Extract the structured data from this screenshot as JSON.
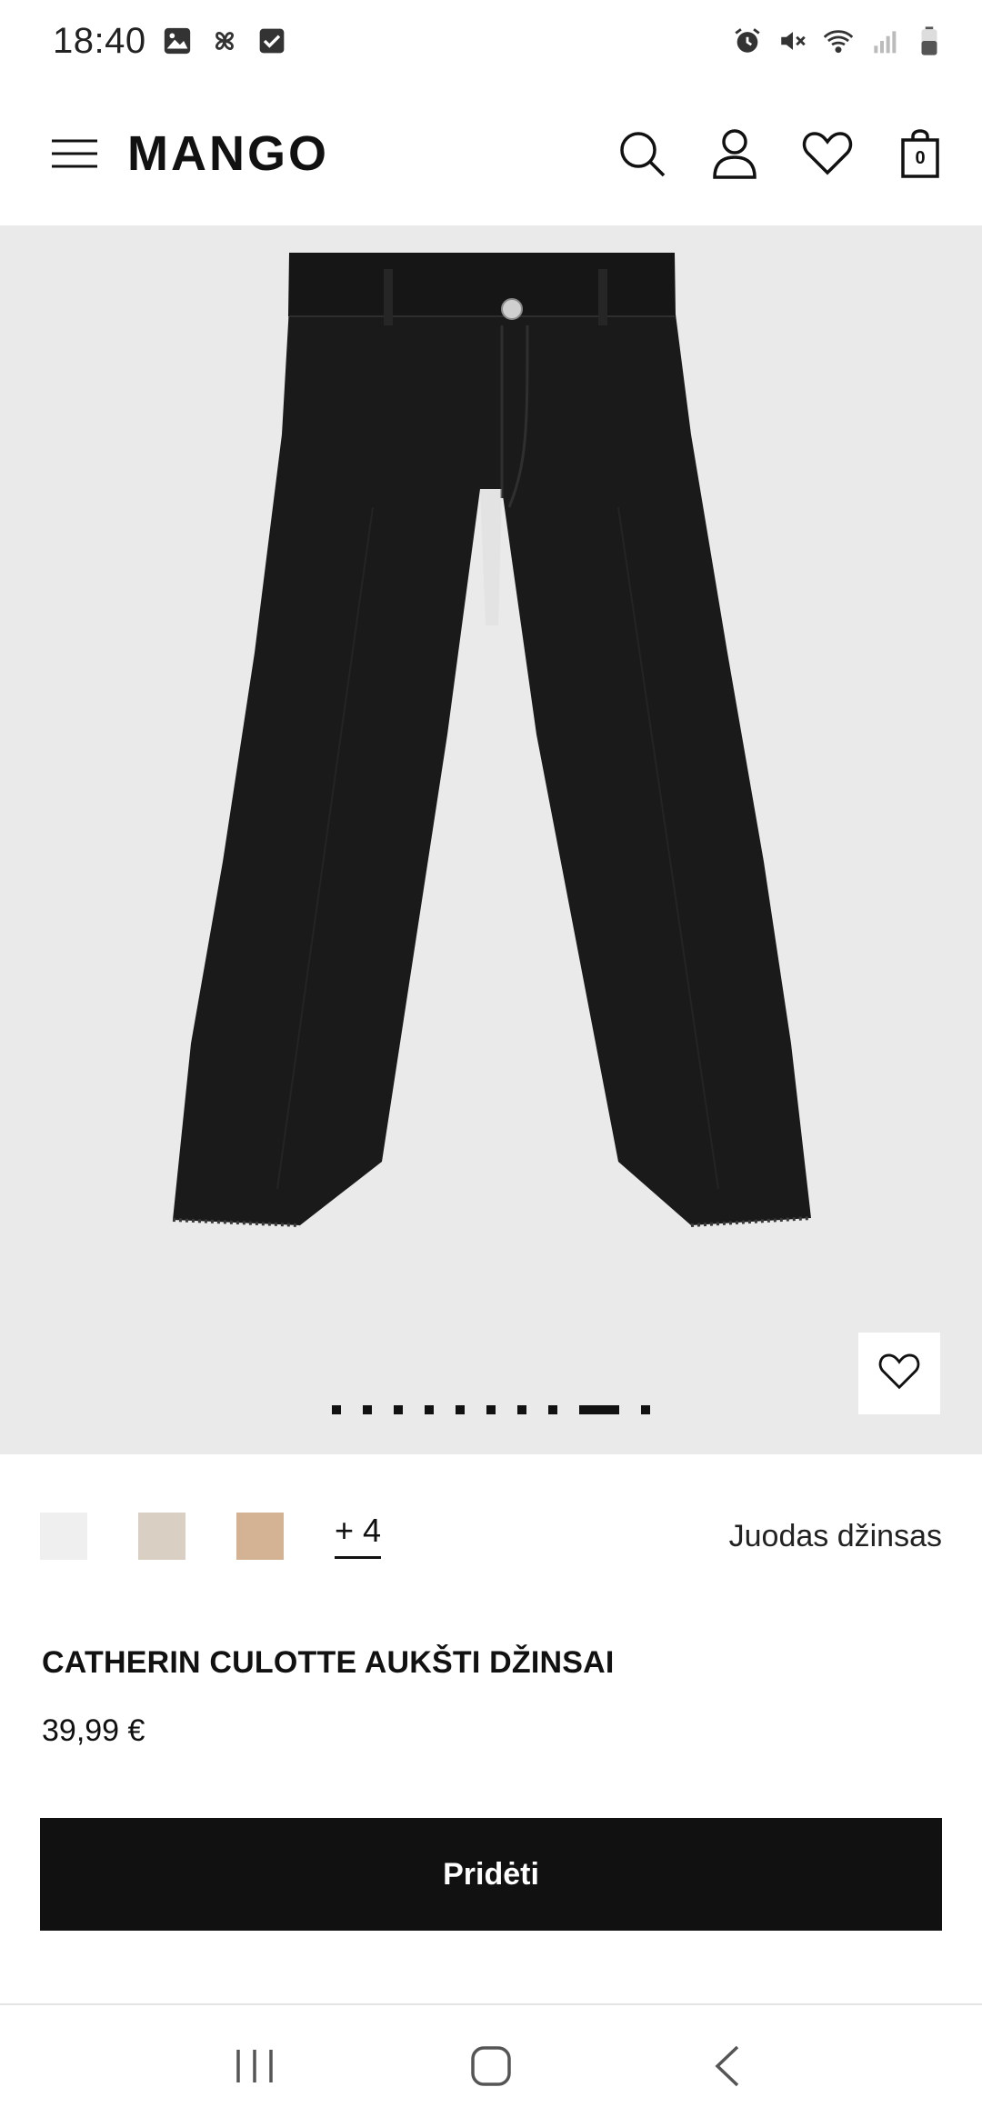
{
  "status_bar": {
    "time": "18:40",
    "left_icons": [
      "gallery-icon",
      "pinwheel-icon",
      "checkbox-icon"
    ],
    "right_icons": [
      "alarm-icon",
      "mute-icon",
      "wifi-icon",
      "signal-icon",
      "battery-icon"
    ]
  },
  "header": {
    "logo": "MANGO",
    "menu_icon": "hamburger-menu-icon",
    "icons": [
      "search-icon",
      "user-icon",
      "heart-icon",
      "bag-icon"
    ],
    "bag_count": "0"
  },
  "product": {
    "image_alt": "black wide-leg culotte jeans",
    "carousel": {
      "total": 10,
      "active_index": 8
    },
    "favorite_icon": "heart-icon",
    "swatches": [
      {
        "color": "#efefef"
      },
      {
        "color": "#d9cfc2"
      },
      {
        "color": "#d4b395"
      }
    ],
    "more_colors": "+ 4",
    "color_name": "Juodas džinsas",
    "title": "CATHERIN CULOTTE AUKŠTI DŽINSAI",
    "price": "39,99 €",
    "add_label": "Pridėti"
  },
  "nav_bar": {
    "icons": [
      "recent-apps-icon",
      "home-icon",
      "back-icon"
    ]
  },
  "colors": {
    "image_background": "#eaeaea",
    "jeans": "#1a1a1a",
    "button": "#111111"
  }
}
